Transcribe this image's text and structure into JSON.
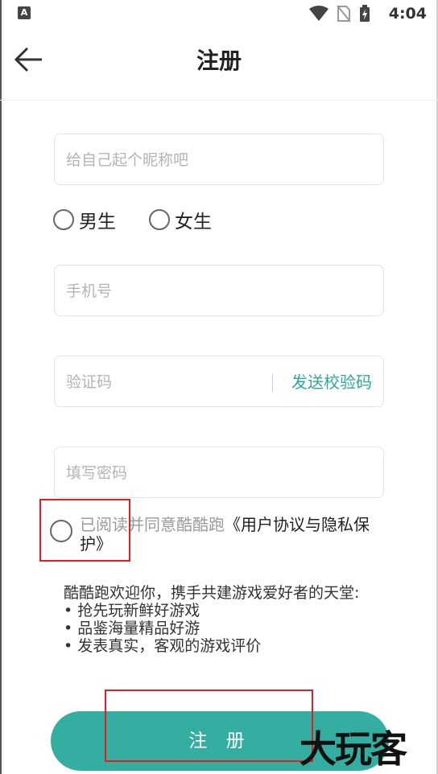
{
  "status_bar": {
    "time": "4:04",
    "app_icon_letter": "A"
  },
  "header": {
    "title": "注册"
  },
  "form": {
    "nickname_placeholder": "给自己起个昵称吧",
    "gender": {
      "male": "男生",
      "female": "女生"
    },
    "phone_placeholder": "手机号",
    "code_placeholder": "验证码",
    "send_code_label": "发送校验码",
    "password_placeholder": "填写密码"
  },
  "agreement": {
    "text": "已阅读并同意酷酷跑",
    "link": "《用户协议与隐私保护》"
  },
  "welcome": {
    "intro": "酷酷跑欢迎你，携手共建游戏爱好者的天堂:",
    "bullets": [
      "• 抢先玩新鲜好游戏",
      "• 品鉴海量精品好游",
      "• 发表真实，客观的游戏评价"
    ]
  },
  "register_button": "注 册",
  "watermark": "大玩客",
  "colors": {
    "accent": "#35aea2",
    "link": "#2ea89b",
    "highlight": "#e02020"
  }
}
